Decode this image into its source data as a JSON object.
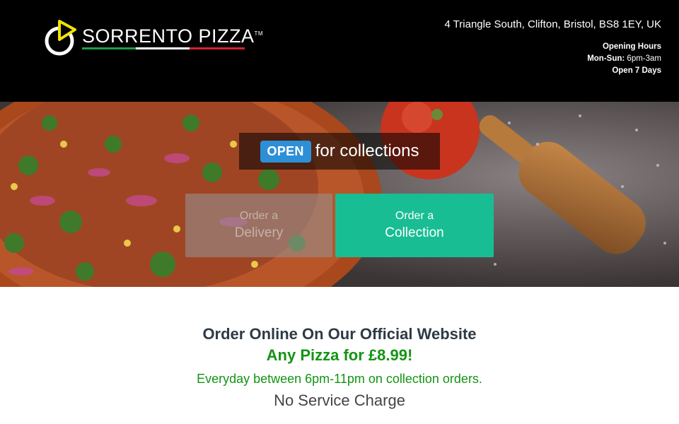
{
  "header": {
    "logo_text": "SORRENTO PIZZA",
    "logo_trademark": "TM",
    "address": "4 Triangle South, Clifton, Bristol, BS8 1EY, UK",
    "hours_title": "Opening Hours",
    "hours_days_label": "Mon-Sun:",
    "hours_days_value": "6pm-3am",
    "hours_note": "Open 7 Days"
  },
  "hero": {
    "status_badge": "OPEN",
    "status_text": "for collections",
    "delivery_button": {
      "line1": "Order a",
      "line2": "Delivery"
    },
    "collection_button": {
      "line1": "Order a",
      "line2": "Collection"
    }
  },
  "promo": {
    "heading": "Order Online On Our Official Website",
    "offer": "Any Pizza for £8.99!",
    "offer_detail": "Everyday between 6pm-11pm on collection orders.",
    "service_note": "No Service Charge"
  },
  "colors": {
    "header_bg": "#000000",
    "open_badge": "#2d8fd6",
    "collection_button": "#19bd94",
    "offer_green": "#149414",
    "heading_dark": "#2e3a45",
    "logo_yellow": "#f2e400"
  },
  "icons": {
    "logo_mark": "pizza-slice-ring-icon"
  }
}
